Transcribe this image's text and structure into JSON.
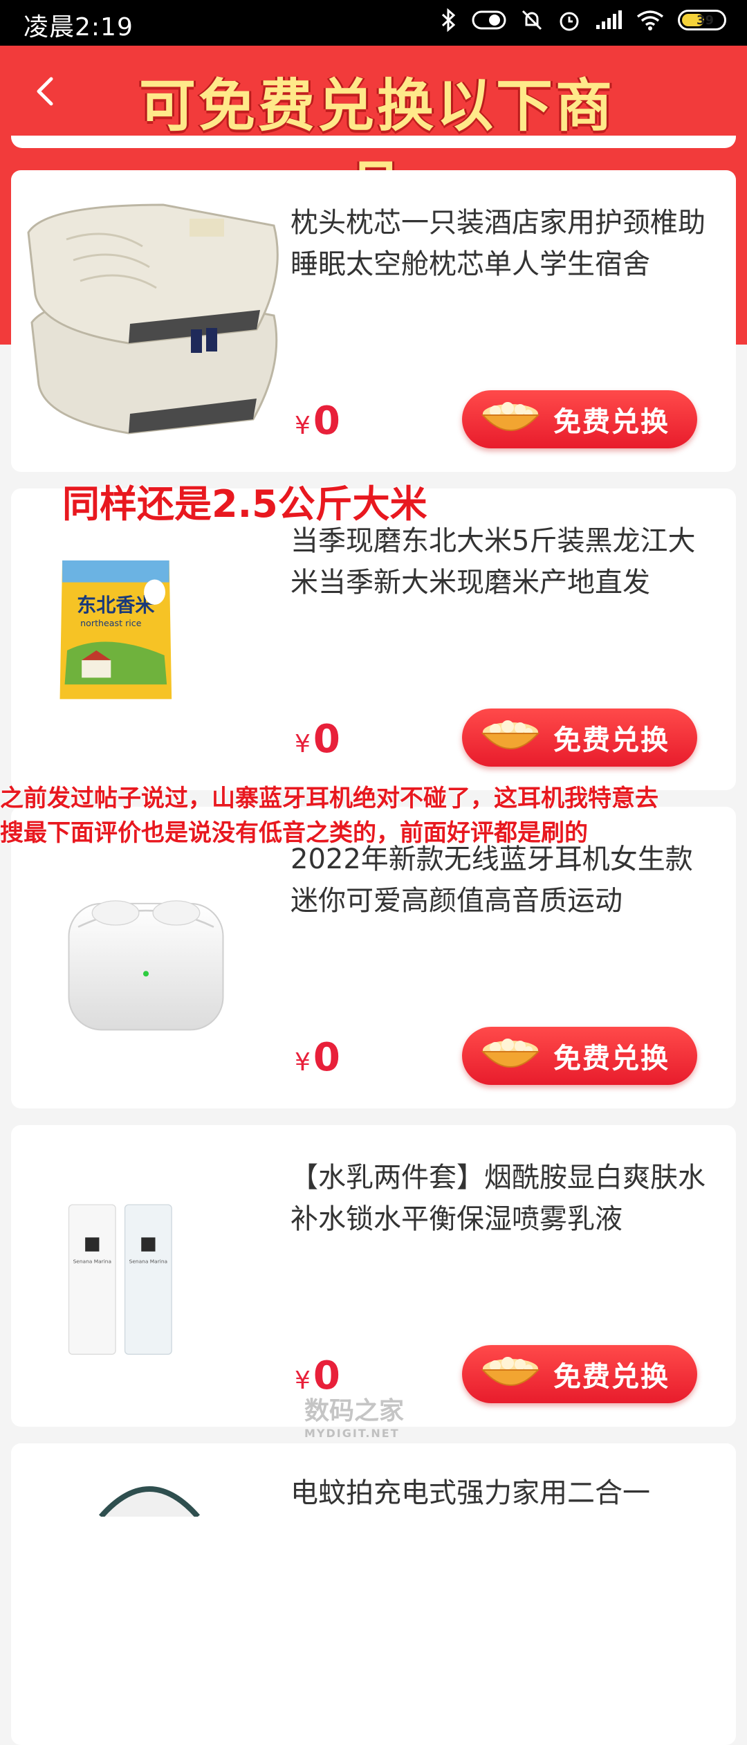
{
  "status_bar": {
    "time": "凌晨2:19",
    "battery": "39"
  },
  "header": {
    "title": "可免费兑换以下商品",
    "back_icon": "chevron-left-icon"
  },
  "colors": {
    "brand_red": "#f23b3b",
    "price_red": "#e8203a",
    "title_yellow": "#ffe98a"
  },
  "products": [
    {
      "title": "枕头枕芯一只装酒店家用护颈椎助睡眠太空舱枕芯单人学生宿舍",
      "price_symbol": "¥",
      "price": "0",
      "button": "免费兑换"
    },
    {
      "title": "当季现磨东北大米5斤装黑龙江大米当季新大米现磨米产地直发",
      "price_symbol": "¥",
      "price": "0",
      "button": "免费兑换",
      "bag_text": "东北香米",
      "bag_subtext": "northeast rice"
    },
    {
      "title": "2022年新款无线蓝牙耳机女生款迷你可爱高颜值高音质运动",
      "price_symbol": "¥",
      "price": "0",
      "button": "免费兑换"
    },
    {
      "title": "【水乳两件套】烟酰胺显白爽肤水补水锁水平衡保湿喷雾乳液",
      "price_symbol": "¥",
      "price": "0",
      "button": "免费兑换",
      "bottle_brand": "Senana Marina"
    },
    {
      "title": "电蚊拍充电式强力家用二合一"
    }
  ],
  "annotations": {
    "rice_note": "同样还是2.5公斤大米",
    "earphone_note_line1": "之前发过帖子说过，山寨蓝牙耳机绝对不碰了，这耳机我特意去",
    "earphone_note_line2": "搜最下面评价也是说没有低音之类的，前面好评都是刷的"
  },
  "watermark": {
    "main": "数码之家",
    "sub": "MYDIGIT.NET"
  }
}
